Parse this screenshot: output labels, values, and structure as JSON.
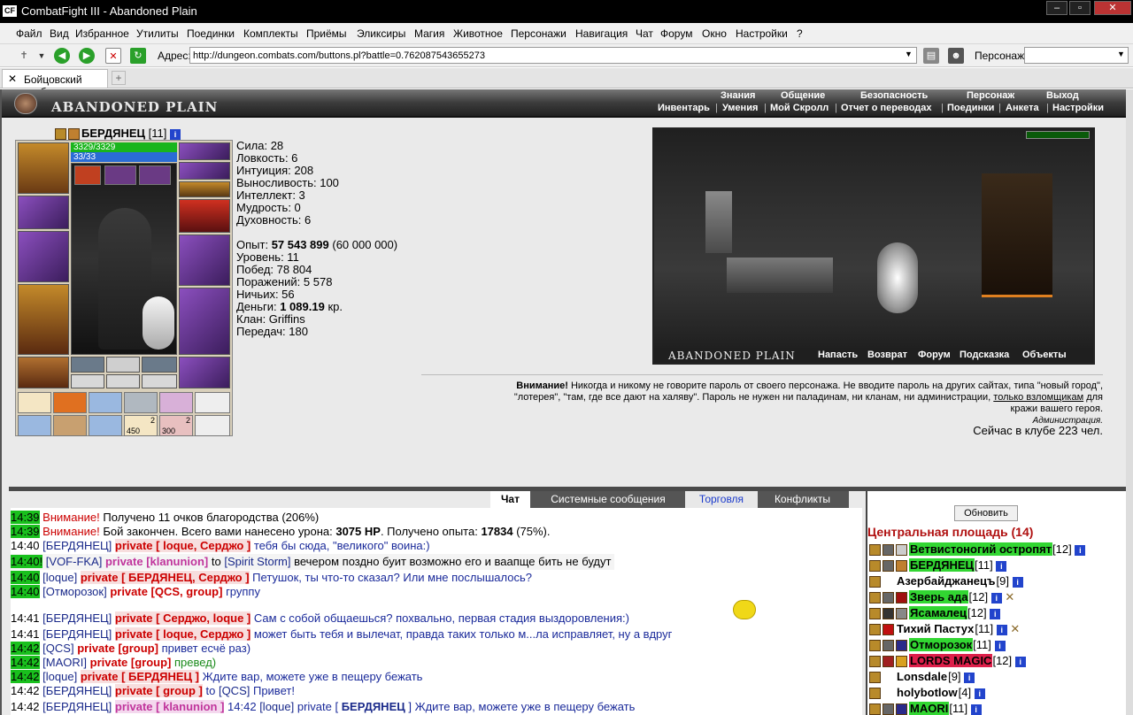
{
  "window": {
    "title": "CombatFight III - Abandoned Plain",
    "icon_label": "CF"
  },
  "menu": [
    "Файл",
    "Вид",
    "Избранное",
    "Утилиты",
    "Поединки",
    "Комплекты",
    "Приёмы",
    "Эликсиры",
    "Магия",
    "Животное",
    "Персонажи",
    "Навигация",
    "Чат",
    "Форум",
    "Окно",
    "Настройки",
    "?"
  ],
  "toolbar": {
    "address_label": "Адрес:",
    "address_value": "http://dungeon.combats.com/buttons.pl?battle=0.762087543655273",
    "character_label": "Персонаж:"
  },
  "tabs": {
    "active_label": "Бойцовский клуб"
  },
  "banner": {
    "location_name": "ABANDONED PLAIN",
    "nav_row1": [
      "Знания",
      "Общение",
      "Безопасность",
      "Персонаж",
      "Выход"
    ],
    "nav_row2": [
      "Инвентарь",
      "Умения",
      "Мой Скролл",
      "Отчет о переводах",
      "Поединки",
      "Анкета",
      "Настройки"
    ]
  },
  "character": {
    "name": "БЕРДЯНЕЦ",
    "level": "[11]",
    "hp": "3329/3329",
    "mana": "33/33",
    "hp_fraction": 1.0,
    "mana_fraction": 1.0,
    "scroll_counts": [
      "450",
      "300"
    ],
    "scroll_badges": [
      "2",
      "2"
    ]
  },
  "stats": {
    "attrs": [
      "Сила: 28",
      "Ловкость: 6",
      "Интуиция: 208",
      "Выносливость: 100",
      "Интеллект: 3",
      "Мудрость: 0",
      "Духовность: 6"
    ],
    "exp_label": "Опыт: ",
    "exp_value": "57 543 899",
    "exp_next": " (60 000 000)",
    "level": "Уровень: 11",
    "wins": "Побед: 78 804",
    "losses": "Поражений: 5 578",
    "draws": "Ничьих: 56",
    "money_label": "Деньги: ",
    "money_value": "1 089.19",
    "money_unit": " кр.",
    "clan": "Клан: Griffins",
    "transfers": "Передач: 180"
  },
  "scene": {
    "title": "ABANDONED PLAIN",
    "links": [
      "Напасть",
      "Возврат",
      "Форум",
      "Подсказка",
      "Объекты"
    ]
  },
  "warning": {
    "bold": "Внимание!",
    "text1": " Никогда и никому не говорите пароль от своего персонажа. Не вводите пароль на других сайтах, типа \"новый город\",",
    "text2": "\"лотерея\", \"там, где все дают на халяву\". Пароль не нужен ни паладинам, ни кланам, ни администрации,",
    "link": "только взломщикам",
    "text3": " для",
    "text4": "кражи вашего героя.",
    "sign": "Администрация.",
    "online": "Сейчас в клубе 223 чел."
  },
  "chat_tabs": [
    "Чат",
    "Системные сообщения",
    "Торговля",
    "Конфликты"
  ],
  "chat": {
    "l1": {
      "t": "14:39",
      "w": "Внимание!",
      "m": " Получено 11 очков благородства (206%)"
    },
    "l2": {
      "t": "14:39",
      "w": "Внимание!",
      "m1": " Бой закончен. Всего вами нанесено урона: ",
      "b1": "3075 HP",
      "m2": ". Получено опыта: ",
      "b2": "17834",
      "m3": " (75%)."
    },
    "l3": {
      "t": "14:40",
      "n": "[БЕРДЯНЕЦ]",
      "p": "private [ loque, Серджо ]",
      "m": "тебя бы сюда, \"великого\" воина:)"
    },
    "l4": {
      "t": "14:40!",
      "n": "[VOF-FKA]",
      "p": "private [klanunion]",
      "m1": " to ",
      "n2": "[Spirit Storm]",
      "m2": " вечером поздно буит возможно его и ваапще бить не будут"
    },
    "l5": {
      "t": "14:40",
      "n": "[loque]",
      "p": "private [ БЕРДЯНЕЦ, Серджо ]",
      "m": "Петушок, ты что-то сказал? Или мне послышалось?"
    },
    "l6": {
      "t": "14:40",
      "n": "[Отморозок]",
      "p": "private [QCS, group]",
      "m": "группу"
    },
    "l7": {
      "t": "14:41",
      "n": "[БЕРДЯНЕЦ]",
      "p": "private [ Серджо, loque ]",
      "m": "Сам с собой общаешься? похвально, первая стадия выздоровления:)"
    },
    "l8": {
      "t": "14:41",
      "n": "[БЕРДЯНЕЦ]",
      "p": "private [ loque, Серджо ]",
      "m": "может быть тебя и вылечат, правда таких только м...ла исправляет, ну а вдруг"
    },
    "l9": {
      "t": "14:42",
      "n": "[QCS]",
      "p": "private [group]",
      "m": "привет есчё раз)"
    },
    "l10": {
      "t": "14:42",
      "n": "[MAORI]",
      "p": "private [group]",
      "m": "превед)"
    },
    "l11": {
      "t": "14:42",
      "n": "[loque]",
      "p": "private [ БЕРДЯНЕЦ ]",
      "m": "Ждите вар, можете уже в пещеру бежать"
    },
    "l12": {
      "t": "14:42",
      "n": "[БЕРДЯНЕЦ]",
      "p": "private [ group ]",
      "m1": "to ",
      "n2": "[QCS]",
      "m2": " Привет!"
    },
    "l13": {
      "t": "14:42",
      "n": "[БЕРДЯНЕЦ]",
      "p": "private [ klanunion ]",
      "m1": " 14:42 ",
      "n2": "[loque]",
      "m2": " private [ ",
      "b": "БЕРДЯНЕЦ",
      "m3": " ] Ждите вар, можете уже в пещеру бежать"
    }
  },
  "right_panel": {
    "refresh": "Обновить",
    "room": "Центральная площадь (14)",
    "players": [
      {
        "name": "Ветвистоногий остропят",
        "level": "[12]"
      },
      {
        "name": "БЕРДЯНЕЦ",
        "level": "[11]"
      },
      {
        "name": "Азербайджанецъ",
        "level": "[9]"
      },
      {
        "name": "Зверь ада",
        "level": "[12]"
      },
      {
        "name": "Ясамалец",
        "level": "[12]"
      },
      {
        "name": "Тихий Пастух",
        "level": "[11]"
      },
      {
        "name": "Отморозок",
        "level": "[11]"
      },
      {
        "name": "LORDS MAGIC",
        "level": "[12]"
      },
      {
        "name": "Lonsdale",
        "level": "[9]"
      },
      {
        "name": "holybotlow",
        "level": "[4]"
      },
      {
        "name": "MAORI",
        "level": "[11]"
      }
    ]
  },
  "colors": {
    "hp": "#19b51c",
    "mana": "#2a6cd5",
    "timestamp": "#19c01d",
    "private": "#cc0000",
    "room": "#b01010"
  }
}
